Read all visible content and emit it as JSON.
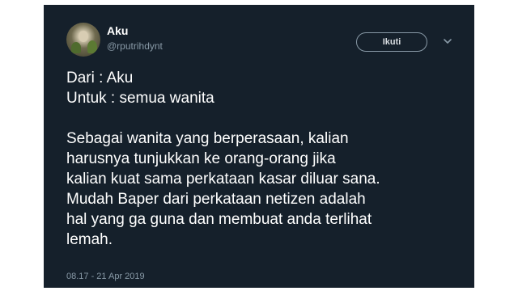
{
  "tweet": {
    "author_name": "Aku",
    "author_handle": "@rputrihdynt",
    "follow_label": "Ikuti",
    "lines_block1": [
      "Dari : Aku",
      "Untuk : semua wanita"
    ],
    "lines_block2": [
      "Sebagai wanita yang berperasaan, kalian",
      "harusnya tunjukkan ke orang-orang jika",
      "kalian kuat sama perkataan kasar diluar sana.",
      "Mudah Baper dari perkataan netizen adalah",
      "hal yang ga guna dan membuat anda terlihat",
      "lemah."
    ],
    "timestamp": "08.17 - 21 Apr 2019"
  },
  "colors": {
    "background": "#15202b",
    "text_primary": "#ffffff",
    "text_secondary": "#8899a6"
  },
  "icons": [
    "avatar-image",
    "chevron-down-icon"
  ]
}
